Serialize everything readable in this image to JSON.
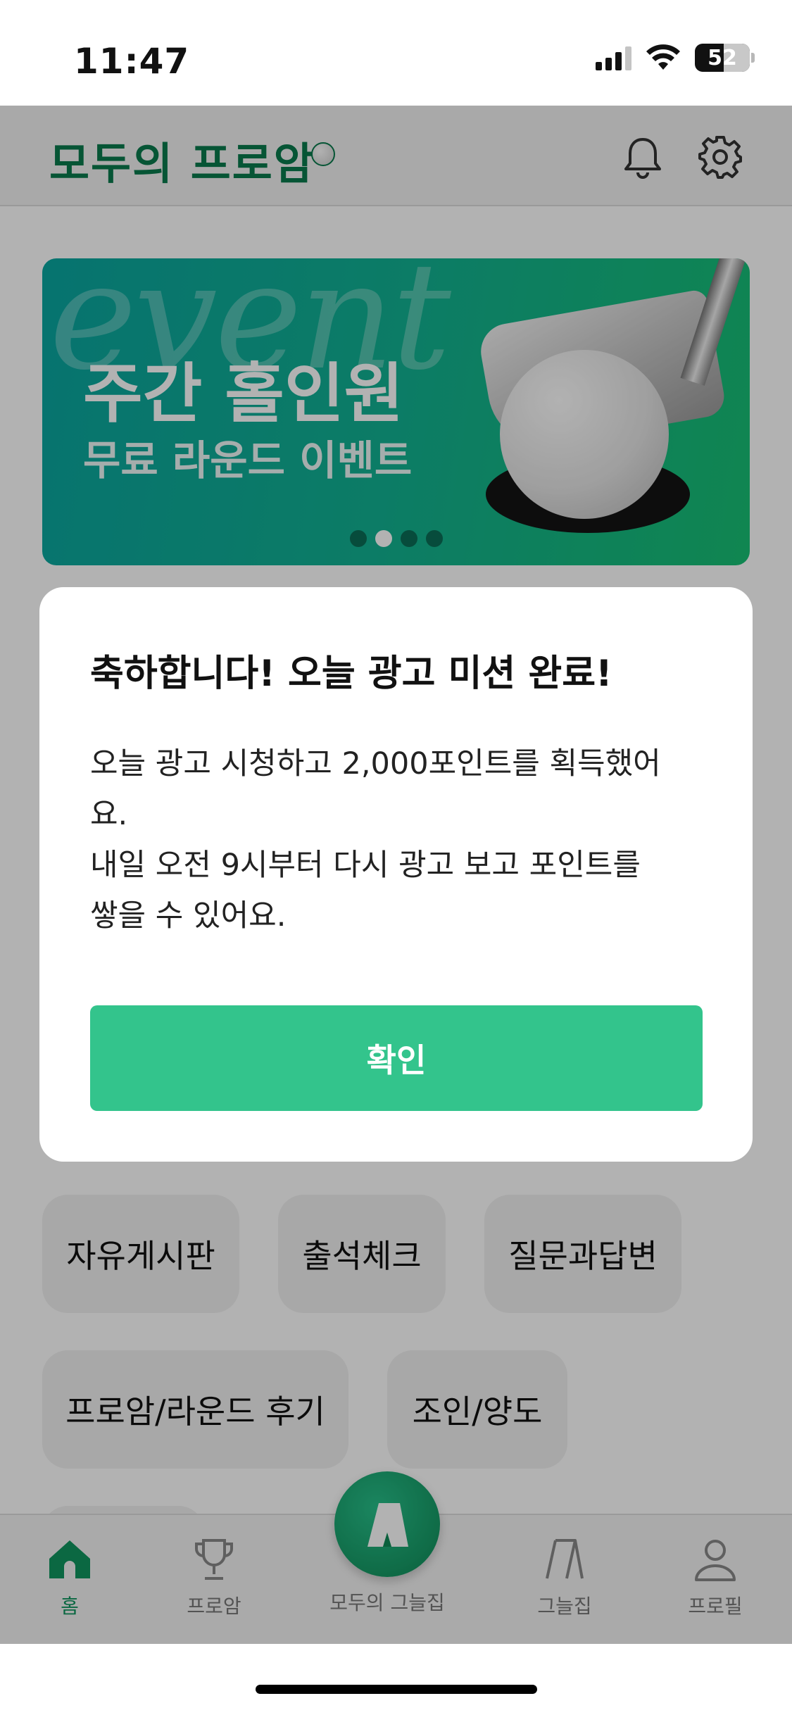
{
  "status_bar": {
    "time": "11:47",
    "battery": "52"
  },
  "header": {
    "logo_text": "모두의 프로암"
  },
  "banner": {
    "script_text": "event",
    "title": "주간 홀인원",
    "subtitle": "무료 라운드 이벤트",
    "slide_count": 4,
    "active_slide": 2
  },
  "categories": [
    {
      "label": "자유게시판"
    },
    {
      "label": "출석체크"
    },
    {
      "label": "질문과답변"
    },
    {
      "label": "프로암/라운드 후기"
    },
    {
      "label": "조인/양도"
    }
  ],
  "modal": {
    "title": "축하합니다! 오늘 광고 미션 완료!",
    "body": "오늘 광고 시청하고 2,000포인트를 획득했어\n요.\n내일 오전 9시부터 다시 광고 보고 포인트를\n쌓을 수 있어요.",
    "confirm_label": "확인"
  },
  "tabbar": {
    "home": "홈",
    "proam": "프로암",
    "center": "모두의 그늘집",
    "shade": "그늘집",
    "profile": "프로필"
  },
  "colors": {
    "brand_green": "#0a7a4c",
    "confirm_button": "#33c48c",
    "active_tab": "#11955f"
  }
}
